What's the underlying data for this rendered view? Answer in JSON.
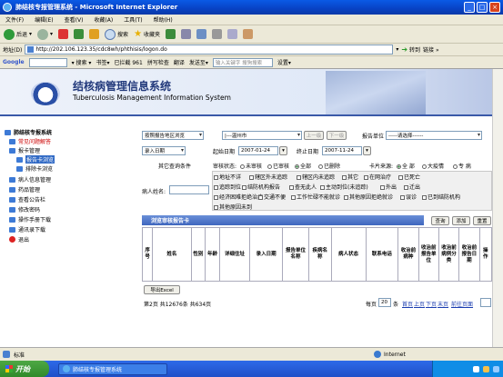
{
  "window": {
    "title": "肺结核专报管理系统 - Microsoft Internet Explorer"
  },
  "menu": [
    "文件(F)",
    "编辑(E)",
    "查看(V)",
    "收藏(A)",
    "工具(T)",
    "帮助(H)"
  ],
  "toolbar": {
    "back": "后退",
    "search": "搜索",
    "favorites": "收藏夹"
  },
  "address": {
    "label": "地址(D)",
    "url": "http://202.106.123.35/cdc8wh/phthisis/logon.do",
    "go": "转到"
  },
  "google": {
    "label": "Google",
    "bookmarks": "书签▾",
    "blocked": "已拦截 961",
    "spellcheck": "拼写检查",
    "translate": "翻译",
    "sendto": "发送至▾",
    "search_hint": "输入关键字 搜狗搜索",
    "settings": "设置▾"
  },
  "banner": {
    "title_cn": "结核病管理信息系统",
    "title_en": "Tuberculosis Management Information System"
  },
  "sidebar": [
    {
      "label": "肺结核专报系统",
      "bold": true,
      "color": "#000000"
    },
    {
      "label": "常见问题解答",
      "bold": false,
      "color": "#cc0000"
    },
    {
      "label": "报卡管理",
      "bold": false,
      "color": "#000000"
    },
    {
      "label": "报告卡浏览",
      "bold": false,
      "color": "#ffffff",
      "selected": true
    },
    {
      "label": "排除卡浏览",
      "bold": false,
      "color": "#000000"
    },
    {
      "label": "病人信息管理",
      "bold": false,
      "color": "#000000"
    },
    {
      "label": "药品管理",
      "bold": false,
      "color": "#000000"
    },
    {
      "label": "查看公告栏",
      "bold": false,
      "color": "#000000"
    },
    {
      "label": "修改密码",
      "bold": false,
      "color": "#000000"
    },
    {
      "label": "操作手册下载",
      "bold": false,
      "color": "#000000"
    },
    {
      "label": "通讯录下载",
      "bold": false,
      "color": "#000000"
    },
    {
      "label": "退出",
      "bold": false,
      "color": "#000000"
    }
  ],
  "form": {
    "area_mode": "按照报告地区浏览",
    "region": "|---温州市",
    "prev_level": "上一级",
    "next_level": "下一级",
    "report_unit_label": "报告单位",
    "report_unit": "-----请选择------",
    "date_type": "录入日期",
    "start_label": "起始日期",
    "start_date": "2007-01-24",
    "end_label": "终止日期",
    "end_date": "2007-11-24",
    "other_label": "其它查询条件",
    "audit_label": "审核状态:",
    "audit_options": [
      "未审核",
      "已审核",
      "全部",
      "已删除"
    ],
    "audit_selected": 2,
    "source_label": "卡片来源:",
    "source_options": [
      "全 部",
      "大疫情",
      "专 病"
    ],
    "source_selected": 0,
    "patient_label": "病人姓名:",
    "addr_label": "地址不详",
    "checks_row1": [
      "辖区外未追踪",
      "辖区内未追踪",
      "其它",
      "在网治疗",
      "已死亡"
    ],
    "checks_row2": [
      "追踪到位",
      "结防机构报告",
      "查无此人",
      "主动到位(未追踪)",
      "外出",
      "迁出"
    ],
    "checks_row3": [
      "经济困难拒绝治疗",
      "交通不便",
      "工作忙碌不能就诊",
      "其他原因拒绝就诊",
      "误诊",
      "已到结防机构"
    ],
    "checks_row4": [
      "其他原因未到"
    ]
  },
  "table": {
    "tab_label": "浏览审核报告卡",
    "buttons": [
      "查询",
      "添加",
      "重置"
    ],
    "headers": [
      "序号",
      "姓名",
      "性别",
      "年龄",
      "详细住址",
      "录入日期",
      "报告单位名称",
      "疾病名称",
      "病人状态",
      "联系电话",
      "收治前病种",
      "收治前报告单位",
      "收治前病例分类",
      "收治前报告日期",
      "操作"
    ]
  },
  "footer": {
    "export": "导出Excel",
    "page_info": "第2页 共12676条 共634页",
    "per_page_label": "每页",
    "per_page": "20",
    "per_page_unit": "条",
    "nav": [
      "首页",
      "上页",
      "下页",
      "末页"
    ],
    "goto": "前往页面"
  },
  "statusbar": {
    "text": "标准",
    "zone": "Internet"
  },
  "taskbar": {
    "start": "开始",
    "task": "肺结核专报管理系统"
  },
  "colors": {
    "banner_accent": "#3a59a8",
    "tab_blue": "#3f66be",
    "link_red": "#cc0000"
  }
}
